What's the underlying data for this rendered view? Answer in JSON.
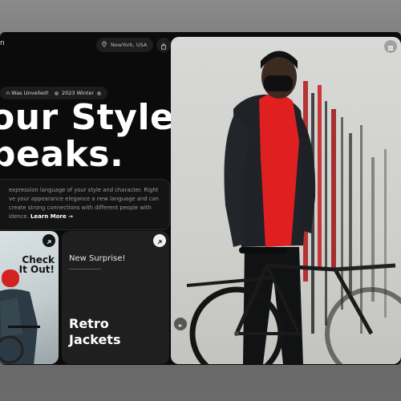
{
  "header": {
    "logo_fragment": "n",
    "location": "NewYork, USA"
  },
  "tags": {
    "unveiled": "n Was Unveiled!",
    "season": "2023 Winter"
  },
  "hero": {
    "headline_line1": "our Style",
    "headline_line2": "peaks."
  },
  "description": {
    "text": "expression language of your style and character. Right ve your appearance elegance a new language and can create strong connections with different people with idence.",
    "link": "Learn More →"
  },
  "promo_card": {
    "line1": "Check",
    "line2": "It Out!"
  },
  "feature_card": {
    "kicker": "New Surprise!",
    "title_line1": "Retro",
    "title_line2": "Jackets"
  },
  "colors": {
    "background": "#0b0b0b",
    "accent_red": "#e02020",
    "card_dark": "#1f1f1f"
  }
}
